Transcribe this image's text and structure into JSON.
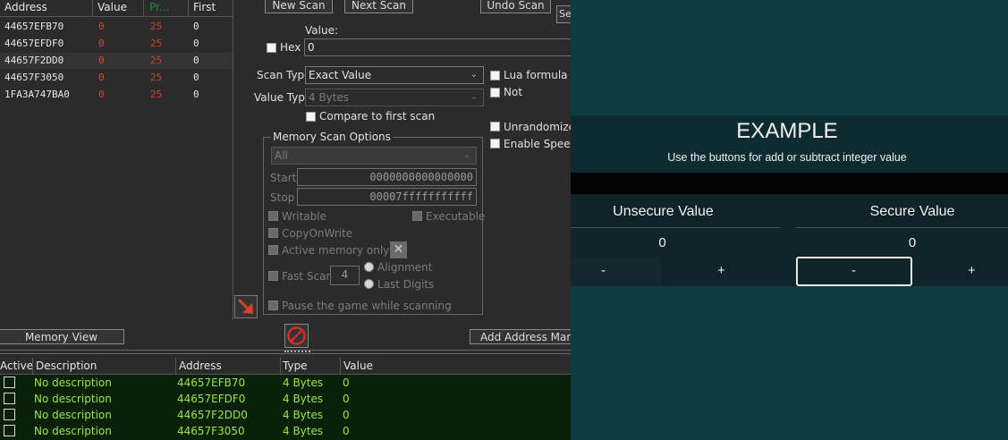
{
  "scan_results": {
    "columns": [
      "Address",
      "Value",
      "Pr...",
      "First"
    ],
    "rows": [
      {
        "address": "44657EFB70",
        "value": "0",
        "previous": "25",
        "first": "0"
      },
      {
        "address": "44657EFDF0",
        "value": "0",
        "previous": "25",
        "first": "0"
      },
      {
        "address": "44657F2DD0",
        "value": "0",
        "previous": "25",
        "first": "0"
      },
      {
        "address": "44657F3050",
        "value": "0",
        "previous": "25",
        "first": "0"
      },
      {
        "address": "1FA3A747BA0",
        "value": "0",
        "previous": "25",
        "first": "0"
      }
    ]
  },
  "scan_panel": {
    "new_scan": "New Scan",
    "next_scan": "Next Scan",
    "undo_scan": "Undo Scan",
    "settings_cut": "Se",
    "value_label": "Value:",
    "hex_label": "Hex",
    "value_input": "0",
    "scan_type_label": "Scan Type",
    "scan_type_value": "Exact Value",
    "value_type_label": "Value Type",
    "value_type_value": "4 Bytes",
    "compare_first": "Compare to first scan",
    "lua_formula": "Lua formula",
    "not_label": "Not",
    "unrandomizer": "Unrandomizer",
    "enable_speedhack": "Enable Speedh",
    "memory_options_title": "Memory Scan Options",
    "region_value": "All",
    "start_label": "Start",
    "start_value": "0000000000000000",
    "stop_label": "Stop",
    "stop_value": "00007fffffffffff",
    "writable": "Writable",
    "executable": "Executable",
    "copy_on_write": "CopyOnWrite",
    "active_memory": "Active memory only",
    "fast_scan": "Fast Scan",
    "fast_scan_value": "4",
    "alignment": "Alignment",
    "last_digits": "Last Digits",
    "pause_game": "Pause the game while scanning"
  },
  "toolbar": {
    "memory_view": "Memory View",
    "add_address": "Add Address Manu"
  },
  "address_list": {
    "columns": [
      "Active",
      "Description",
      "Address",
      "Type",
      "Value"
    ],
    "rows": [
      {
        "description": "No description",
        "address": "44657EFB70",
        "type": "4 Bytes",
        "value": "0"
      },
      {
        "description": "No description",
        "address": "44657EFDF0",
        "type": "4 Bytes",
        "value": "0"
      },
      {
        "description": "No description",
        "address": "44657F2DD0",
        "type": "4 Bytes",
        "value": "0"
      },
      {
        "description": "No description",
        "address": "44657F3050",
        "type": "4 Bytes",
        "value": "0"
      }
    ]
  },
  "game": {
    "title": "EXAMPLE",
    "subtitle": "Use the buttons for add or subtract integer value",
    "unsecure_label": "Unsecure Value",
    "unsecure_value": "0",
    "secure_label": "Secure Value",
    "secure_value": "0",
    "minus": "-",
    "plus": "+"
  },
  "colors": {
    "value_red": "#e0452c",
    "previous_red": "#c8442e",
    "list_green": "#9ce34a",
    "game_bg": "#0f3b45"
  },
  "icons": [
    "arrow-down-right-icon",
    "stop-icon",
    "close-icon"
  ]
}
